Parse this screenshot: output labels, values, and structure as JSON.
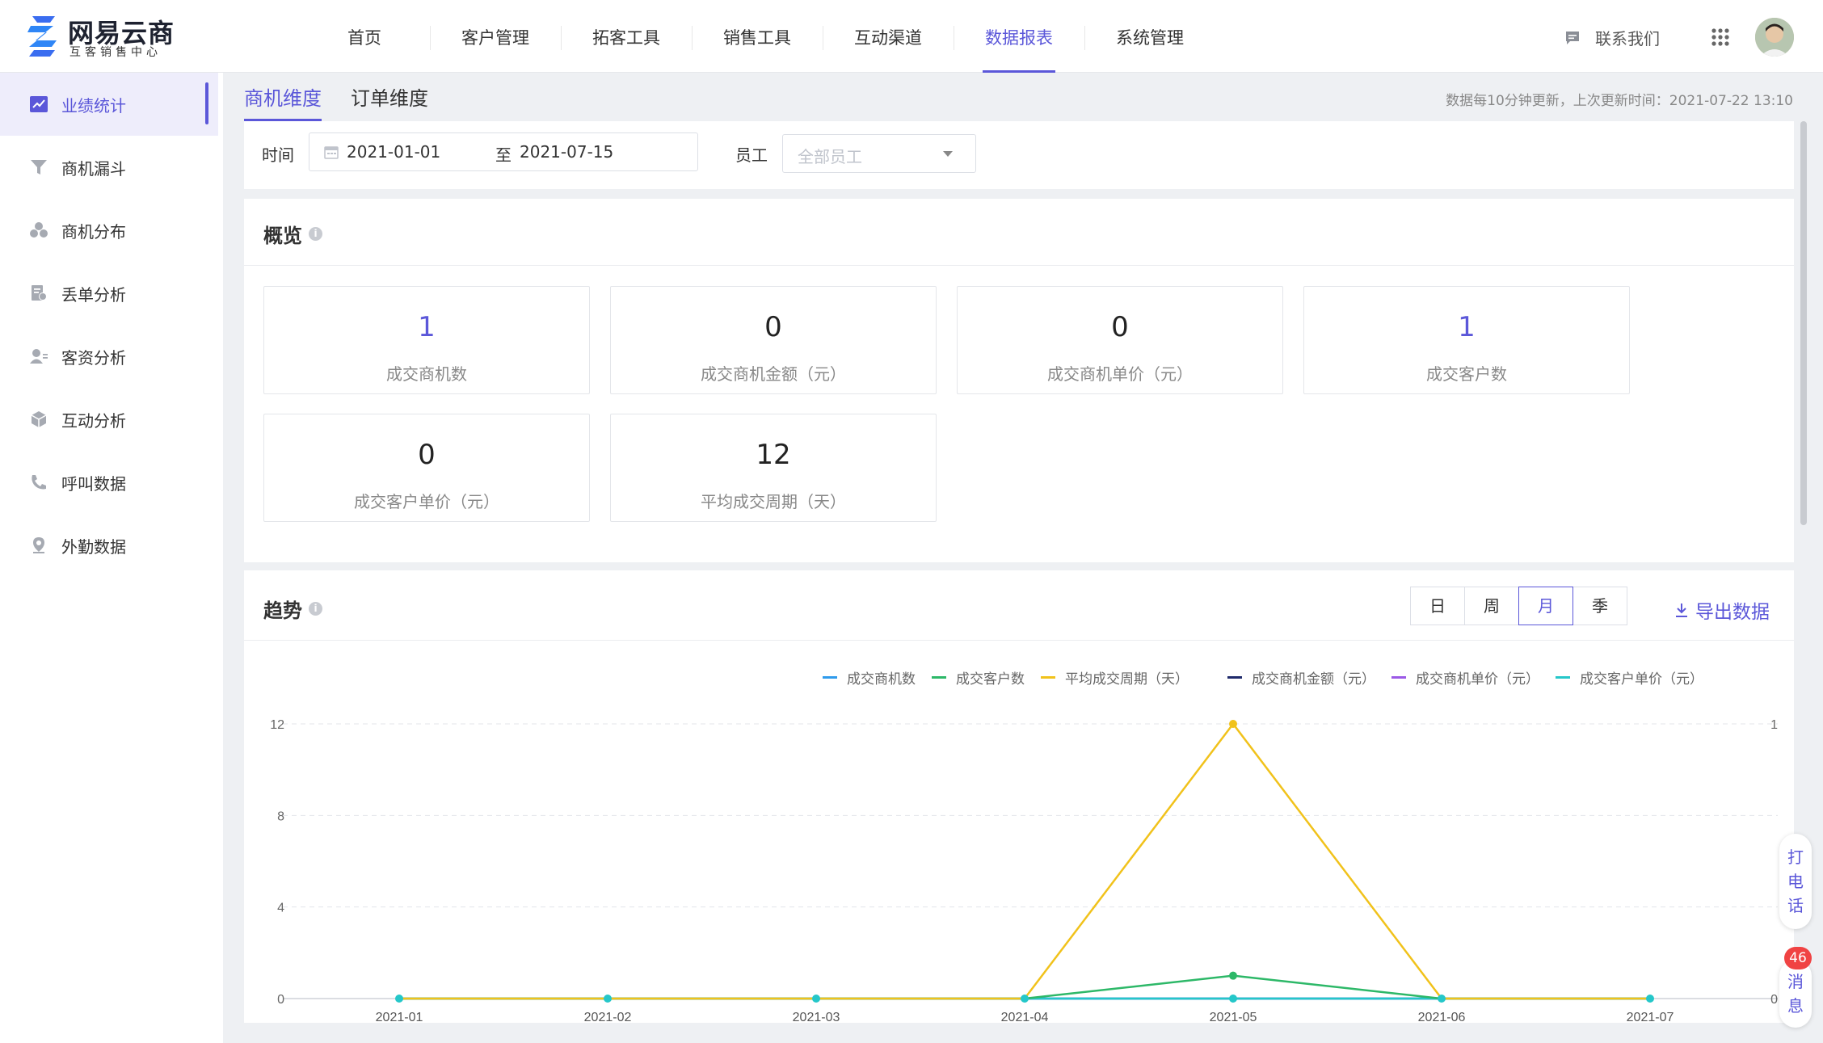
{
  "brand": {
    "name": "网易云商",
    "subtitle": "互客销售中心"
  },
  "nav": {
    "items": [
      {
        "label": "首页"
      },
      {
        "label": "客户管理"
      },
      {
        "label": "拓客工具"
      },
      {
        "label": "销售工具"
      },
      {
        "label": "互动渠道"
      },
      {
        "label": "数据报表",
        "active": true
      },
      {
        "label": "系统管理"
      }
    ],
    "contact_label": "联系我们",
    "accent_color": "#5b57d9"
  },
  "sidebar": {
    "items": [
      {
        "label": "业绩统计",
        "icon": "line-chart-icon",
        "active": true
      },
      {
        "label": "商机漏斗",
        "icon": "funnel-icon"
      },
      {
        "label": "商机分布",
        "icon": "distribution-icon"
      },
      {
        "label": "丢单分析",
        "icon": "lost-order-icon"
      },
      {
        "label": "客资分析",
        "icon": "customer-icon"
      },
      {
        "label": "互动分析",
        "icon": "cube-icon"
      },
      {
        "label": "呼叫数据",
        "icon": "phone-icon"
      },
      {
        "label": "外勤数据",
        "icon": "location-icon"
      }
    ]
  },
  "subtabs": [
    {
      "label": "商机维度",
      "active": true
    },
    {
      "label": "订单维度"
    }
  ],
  "update_note": "数据每10分钟更新，上次更新时间：2021-07-22 13:10",
  "filters": {
    "time_label": "时间",
    "date_start": "2021-01-01",
    "date_sep": "至",
    "date_end": "2021-07-15",
    "employee_label": "员工",
    "employee_placeholder": "全部员工"
  },
  "overview": {
    "title": "概览",
    "stats": [
      {
        "value": "1",
        "label": "成交商机数",
        "accent": true
      },
      {
        "value": "0",
        "label": "成交商机金额（元）"
      },
      {
        "value": "0",
        "label": "成交商机单价（元）"
      },
      {
        "value": "1",
        "label": "成交客户数",
        "accent": true
      },
      {
        "value": "0",
        "label": "成交客户单价（元）"
      },
      {
        "value": "12",
        "label": "平均成交周期（天）"
      }
    ]
  },
  "trend": {
    "title": "趋势",
    "periods": [
      {
        "label": "日"
      },
      {
        "label": "周"
      },
      {
        "label": "月",
        "active": true
      },
      {
        "label": "季"
      }
    ],
    "export_label": "导出数据"
  },
  "chart_data": {
    "type": "line",
    "x": [
      "2021-01",
      "2021-02",
      "2021-03",
      "2021-04",
      "2021-05",
      "2021-06",
      "2021-07"
    ],
    "y_left": {
      "min": 0,
      "max": 12,
      "ticks": [
        0,
        4,
        8,
        12
      ]
    },
    "y_right": {
      "min": 0,
      "max": 1,
      "ticks": [
        0,
        1
      ]
    },
    "grid": true,
    "legend_position": "top-right",
    "series": [
      {
        "name": "成交商机数",
        "color": "#2f9bec",
        "axis": "right",
        "values": [
          0,
          0,
          0,
          0,
          0,
          0,
          0
        ]
      },
      {
        "name": "成交客户数",
        "color": "#2db868",
        "axis": "left",
        "values": [
          0,
          0,
          0,
          0,
          1,
          0,
          0
        ]
      },
      {
        "name": "平均成交周期（天）",
        "color": "#f1c21b",
        "axis": "left",
        "values": [
          0,
          0,
          0,
          0,
          12,
          0,
          0
        ]
      },
      {
        "name": "成交商机金额（元）",
        "color": "#1f2a6b",
        "axis": "left",
        "values": [
          0,
          0,
          0,
          0,
          0,
          0,
          0
        ]
      },
      {
        "name": "成交商机单价（元）",
        "color": "#9b59e6",
        "axis": "left",
        "values": [
          0,
          0,
          0,
          0,
          0,
          0,
          0
        ]
      },
      {
        "name": "成交客户单价（元）",
        "color": "#25c7c9",
        "axis": "left",
        "values": [
          0,
          0,
          0,
          0,
          0,
          0,
          0
        ]
      }
    ]
  },
  "float": {
    "call_label": "打电话",
    "message_label": "消息",
    "message_count": "46"
  }
}
